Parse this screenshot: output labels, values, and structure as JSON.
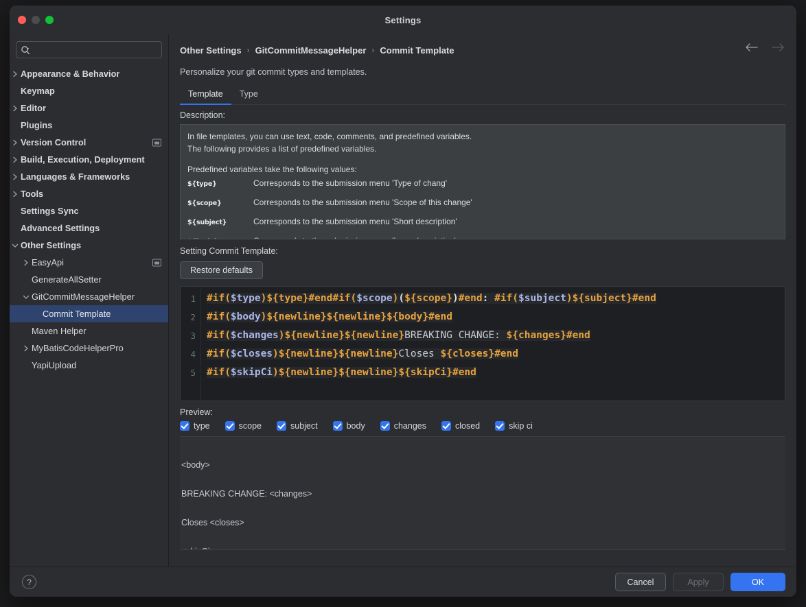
{
  "window": {
    "title": "Settings",
    "traffic_lights": [
      "close-red",
      "minimize-gray",
      "zoom-green"
    ]
  },
  "sidebar": {
    "search": {
      "value": "",
      "placeholder": ""
    },
    "items": [
      {
        "label": "Appearance & Behavior",
        "arrow": "right",
        "indent": 0,
        "bold": true,
        "selected": false,
        "badge": false
      },
      {
        "label": "Keymap",
        "arrow": "none",
        "indent": 0,
        "bold": true,
        "selected": false,
        "badge": false
      },
      {
        "label": "Editor",
        "arrow": "right",
        "indent": 0,
        "bold": true,
        "selected": false,
        "badge": false
      },
      {
        "label": "Plugins",
        "arrow": "none",
        "indent": 0,
        "bold": true,
        "selected": false,
        "badge": false
      },
      {
        "label": "Version Control",
        "arrow": "right",
        "indent": 0,
        "bold": true,
        "selected": false,
        "badge": true
      },
      {
        "label": "Build, Execution, Deployment",
        "arrow": "right",
        "indent": 0,
        "bold": true,
        "selected": false,
        "badge": false
      },
      {
        "label": "Languages & Frameworks",
        "arrow": "right",
        "indent": 0,
        "bold": true,
        "selected": false,
        "badge": false
      },
      {
        "label": "Tools",
        "arrow": "right",
        "indent": 0,
        "bold": true,
        "selected": false,
        "badge": false
      },
      {
        "label": "Settings Sync",
        "arrow": "none",
        "indent": 0,
        "bold": true,
        "selected": false,
        "badge": false
      },
      {
        "label": "Advanced Settings",
        "arrow": "none",
        "indent": 0,
        "bold": true,
        "selected": false,
        "badge": false
      },
      {
        "label": "Other Settings",
        "arrow": "down",
        "indent": 0,
        "bold": true,
        "selected": false,
        "badge": false
      },
      {
        "label": "EasyApi",
        "arrow": "right",
        "indent": 1,
        "bold": false,
        "selected": false,
        "badge": true
      },
      {
        "label": "GenerateAllSetter",
        "arrow": "none",
        "indent": 1,
        "bold": false,
        "selected": false,
        "badge": false
      },
      {
        "label": "GitCommitMessageHelper",
        "arrow": "down",
        "indent": 1,
        "bold": false,
        "selected": false,
        "badge": false
      },
      {
        "label": "Commit Template",
        "arrow": "none",
        "indent": 2,
        "bold": false,
        "selected": true,
        "badge": false
      },
      {
        "label": "Maven Helper",
        "arrow": "none",
        "indent": 1,
        "bold": false,
        "selected": false,
        "badge": false
      },
      {
        "label": "MyBatisCodeHelperPro",
        "arrow": "right",
        "indent": 1,
        "bold": false,
        "selected": false,
        "badge": false
      },
      {
        "label": "YapiUpload",
        "arrow": "none",
        "indent": 1,
        "bold": false,
        "selected": false,
        "badge": false
      }
    ]
  },
  "main": {
    "breadcrumb": [
      "Other Settings",
      "GitCommitMessageHelper",
      "Commit Template"
    ],
    "breadcrumb_separator": "›",
    "nav": {
      "back": "back-arrow",
      "forward": "forward-arrow"
    },
    "subtitle": "Personalize your git commit types and templates.",
    "tabs": [
      {
        "label": "Template",
        "active": true
      },
      {
        "label": "Type",
        "active": false
      }
    ],
    "description_label": "Description:",
    "description": {
      "paragraph": [
        "In file templates, you can use text, code, comments, and predefined variables.",
        "The following provides a list of predefined variables."
      ],
      "variables_intro": "Predefined variables take the following values:",
      "variables": [
        {
          "name": "${type}",
          "desc": "Corresponds to the submission menu 'Type of chang'"
        },
        {
          "name": "${scope}",
          "desc": "Corresponds to the submission menu 'Scope of this change'"
        },
        {
          "name": "${subject}",
          "desc": "Corresponds to the submission menu 'Short description'"
        },
        {
          "name": "${body}",
          "desc": "Corresponds to the submission menu 'Long description'"
        }
      ]
    },
    "setting_label": "Setting Commit Template:",
    "restore_button": "Restore defaults",
    "editor": {
      "line_numbers": [
        "1",
        "2",
        "3",
        "4",
        "5"
      ],
      "lines": [
        [
          {
            "t": "#if(",
            "c": "dir"
          },
          {
            "t": "$type",
            "c": "var"
          },
          {
            "t": ")",
            "c": "dir"
          },
          {
            "t": "${type}",
            "c": "dir"
          },
          {
            "t": "#end",
            "c": "dir"
          },
          {
            "t": "#if(",
            "c": "dir"
          },
          {
            "t": "$scope",
            "c": "var"
          },
          {
            "t": ")",
            "c": "dir"
          },
          {
            "t": "(",
            "c": "white"
          },
          {
            "t": "${scope}",
            "c": "dir"
          },
          {
            "t": ")",
            "c": "white"
          },
          {
            "t": "#end",
            "c": "dir"
          },
          {
            "t": ": ",
            "c": "white"
          },
          {
            "t": "#if(",
            "c": "dir"
          },
          {
            "t": "$subject",
            "c": "var"
          },
          {
            "t": ")",
            "c": "dir"
          },
          {
            "t": "${subject}",
            "c": "dir"
          },
          {
            "t": "#end",
            "c": "dir"
          }
        ],
        [
          {
            "t": "#if(",
            "c": "dir"
          },
          {
            "t": "$body",
            "c": "var"
          },
          {
            "t": ")",
            "c": "dir"
          },
          {
            "t": "${newline}",
            "c": "dir"
          },
          {
            "t": "${newline}",
            "c": "dir"
          },
          {
            "t": "${body}",
            "c": "dir"
          },
          {
            "t": "#end",
            "c": "dir"
          }
        ],
        [
          {
            "t": "#if(",
            "c": "dir"
          },
          {
            "t": "$changes",
            "c": "var"
          },
          {
            "t": ")",
            "c": "dir"
          },
          {
            "t": "${newline}",
            "c": "dir"
          },
          {
            "t": "${newline}",
            "c": "dir"
          },
          {
            "t": "BREAKING CHANGE: ",
            "c": "plain"
          },
          {
            "t": "${changes}",
            "c": "dir"
          },
          {
            "t": "#end",
            "c": "dir"
          }
        ],
        [
          {
            "t": "#if(",
            "c": "dir"
          },
          {
            "t": "$closes",
            "c": "var"
          },
          {
            "t": ")",
            "c": "dir"
          },
          {
            "t": "${newline}",
            "c": "dir"
          },
          {
            "t": "${newline}",
            "c": "dir"
          },
          {
            "t": "Closes ",
            "c": "plain"
          },
          {
            "t": "${closes}",
            "c": "dir"
          },
          {
            "t": "#end",
            "c": "dir"
          }
        ],
        [
          {
            "t": "#if(",
            "c": "dir"
          },
          {
            "t": "$skipCi",
            "c": "var"
          },
          {
            "t": ")",
            "c": "dir"
          },
          {
            "t": "${newline}",
            "c": "dir"
          },
          {
            "t": "${newline}",
            "c": "dir"
          },
          {
            "t": "${skipCi}",
            "c": "dir"
          },
          {
            "t": "#end",
            "c": "dir"
          }
        ]
      ]
    },
    "preview_label": "Preview:",
    "preview_checkboxes": [
      {
        "label": "type",
        "checked": true
      },
      {
        "label": "scope",
        "checked": true
      },
      {
        "label": "subject",
        "checked": true
      },
      {
        "label": "body",
        "checked": true
      },
      {
        "label": "changes",
        "checked": true
      },
      {
        "label": "closed",
        "checked": true
      },
      {
        "label": "skip ci",
        "checked": true
      }
    ],
    "preview_text": [
      "",
      "<body>",
      "",
      "BREAKING CHANGE: <changes>",
      "",
      "Closes <closes>",
      "",
      "<skipCi>"
    ]
  },
  "footer": {
    "help": "?",
    "cancel": "Cancel",
    "apply": "Apply",
    "ok": "OK"
  },
  "colors": {
    "accent": "#3574f0",
    "selection": "#2e436e",
    "directive": "#e8a33d",
    "variable": "#a9b7e8",
    "window_bg": "#2b2d30",
    "editor_bg": "#1e1f22",
    "desc_bg": "#3c3f41"
  }
}
